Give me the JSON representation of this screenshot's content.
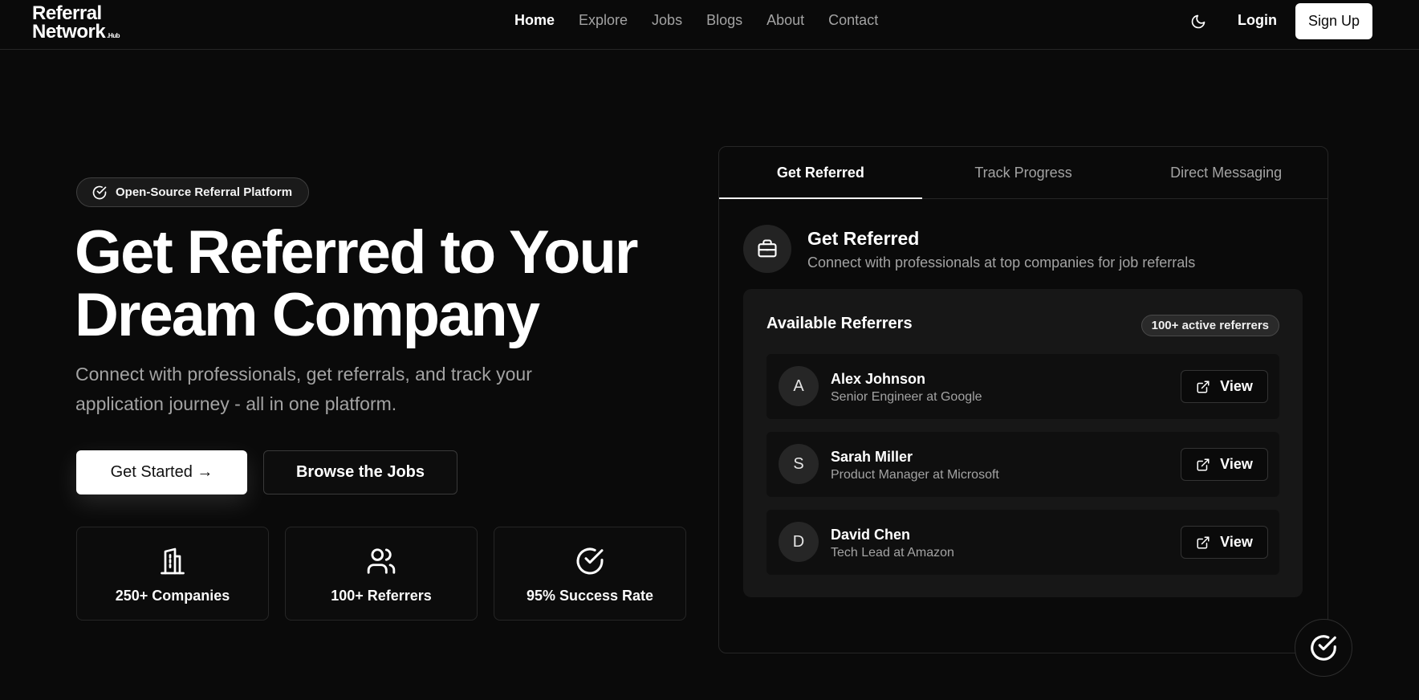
{
  "nav": {
    "logo_line1": "Referral",
    "logo_line2": "Network",
    "logo_suffix": ".Hub",
    "links": [
      {
        "label": "Home",
        "active": true
      },
      {
        "label": "Explore"
      },
      {
        "label": "Jobs"
      },
      {
        "label": "Blogs"
      },
      {
        "label": "About"
      },
      {
        "label": "Contact"
      }
    ],
    "theme_icon": "moon-icon",
    "login_label": "Login",
    "signup_label": "Sign Up"
  },
  "hero": {
    "badge": "Open-Source Referral Platform",
    "badge_icon": "check-circle-icon",
    "title_line1": "Get Referred to Your",
    "title_line2": "Dream Company",
    "subtitle": "Connect with professionals, get referrals, and track your application journey - all in one platform.",
    "primary_cta": "Get Started →",
    "secondary_cta": "Browse the Jobs"
  },
  "stats": [
    {
      "icon": "building-icon",
      "label": "250+ Companies"
    },
    {
      "icon": "users-icon",
      "label": "100+ Referrers"
    },
    {
      "icon": "check-circle-icon",
      "label": "95% Success Rate"
    }
  ],
  "card": {
    "tabs": [
      {
        "label": "Get Referred",
        "active": true
      },
      {
        "label": "Track Progress"
      },
      {
        "label": "Direct Messaging"
      }
    ],
    "feature_icon": "briefcase-icon",
    "feature_title": "Get Referred",
    "feature_desc": "Connect with professionals at top companies for job referrals",
    "panel_title": "Available Referrers",
    "panel_badge": "100+ active referrers",
    "referrers": [
      {
        "initial": "A",
        "name": "Alex Johnson",
        "role": "Senior Engineer at Google",
        "action": "View"
      },
      {
        "initial": "S",
        "name": "Sarah Miller",
        "role": "Product Manager at Microsoft",
        "action": "View"
      },
      {
        "initial": "D",
        "name": "David Chen",
        "role": "Tech Lead at Amazon",
        "action": "View"
      }
    ]
  },
  "fab_icon": "check-circle-icon",
  "colors": {
    "background": "#0a0a0a",
    "panel": "#171717",
    "text": "#fafafa",
    "muted": "#a3a3a3",
    "border": "#262626"
  }
}
